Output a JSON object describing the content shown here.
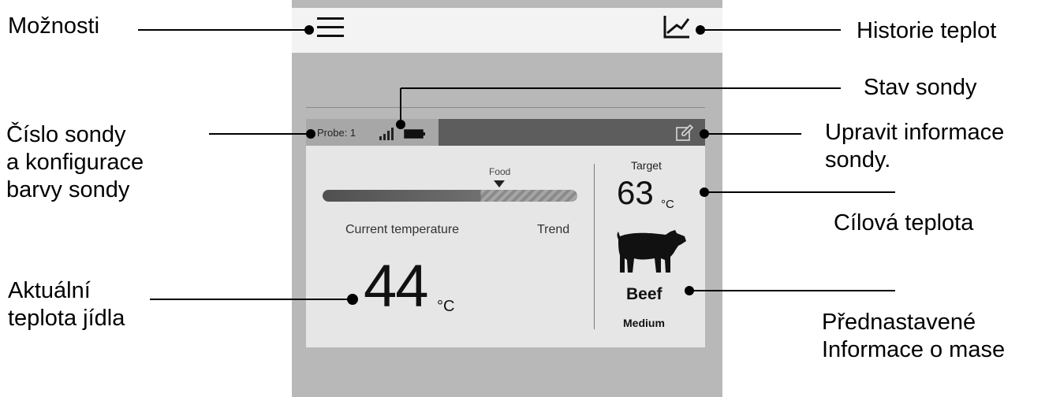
{
  "callouts": {
    "options": "Možnosti",
    "temp_history": "Historie teplot",
    "probe_status": "Stav sondy",
    "probe_number_color": [
      "Číslo sondy",
      "a konfigurace",
      "barvy sondy"
    ],
    "edit_probe_info": [
      "Upravit informace",
      "sondy."
    ],
    "target_temp": "Cílová teplota",
    "current_food_temp": [
      "Aktuální",
      "teplota jídla"
    ],
    "preset_meat_info": [
      "Přednastavené",
      "Informace o mase"
    ]
  },
  "app": {
    "menu_icon": "hamburger-menu-icon",
    "history_icon": "line-chart-icon",
    "probe": {
      "label": "Probe: 1",
      "signal_icon": "signal-strength-icon",
      "battery_icon": "battery-icon",
      "edit_icon": "edit-icon"
    },
    "gauge": {
      "food_label": "Food",
      "current_label": "Current temperature",
      "trend_label": "Trend",
      "progress_fraction": 0.62
    },
    "current_temp": {
      "value": "44",
      "unit": "°C"
    },
    "target": {
      "label": "Target",
      "value": "63",
      "unit": "°C"
    },
    "meat": {
      "icon": "cow-icon",
      "type": "Beef",
      "doneness": "Medium"
    }
  }
}
